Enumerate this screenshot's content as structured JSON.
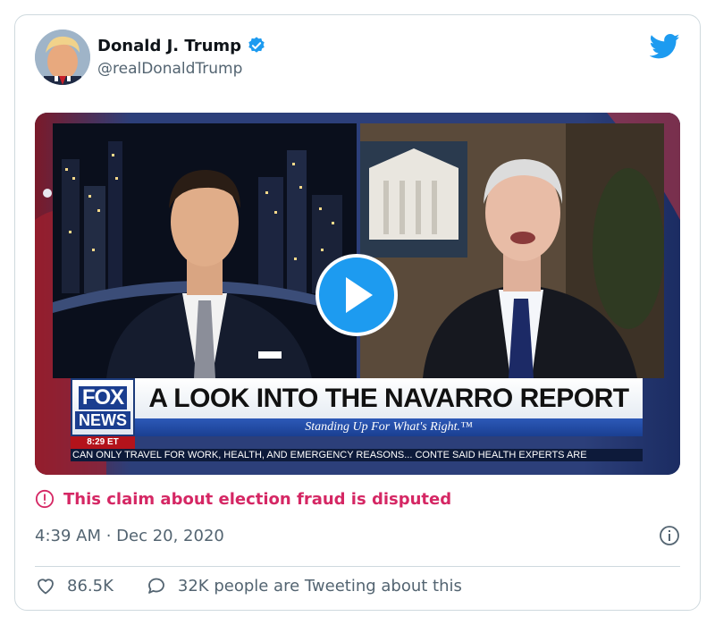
{
  "author": {
    "name": "Donald J. Trump",
    "handle": "@realDonaldTrump",
    "verified": true
  },
  "media": {
    "headline": "A LOOK INTO THE NAVARRO REPORT",
    "subline": "Standing Up For What's Right.™",
    "network_logo_top": "FOX",
    "network_logo_bottom": "NEWS",
    "time": "8:29 ET",
    "ticker": "CAN ONLY TRAVEL FOR WORK, HEALTH, AND EMERGENCY REASONS...   CONTE SAID HEALTH EXPERTS ARE"
  },
  "notice": {
    "text": "This claim about election fraud is disputed",
    "color": "#d52764"
  },
  "timestamp": "4:39 AM · Dec 20, 2020",
  "actions": {
    "likes": "86.5K",
    "conversation": "32K people are Tweeting about this"
  },
  "colors": {
    "accent": "#1d9bf0",
    "muted": "#536471",
    "border": "#cfd9de"
  },
  "icons": {
    "logo": "twitter-bird-icon",
    "verified": "verified-badge-icon",
    "play": "play-icon",
    "notice": "exclamation-circle-icon",
    "info": "info-icon",
    "like": "heart-icon",
    "reply": "speech-bubble-icon"
  }
}
